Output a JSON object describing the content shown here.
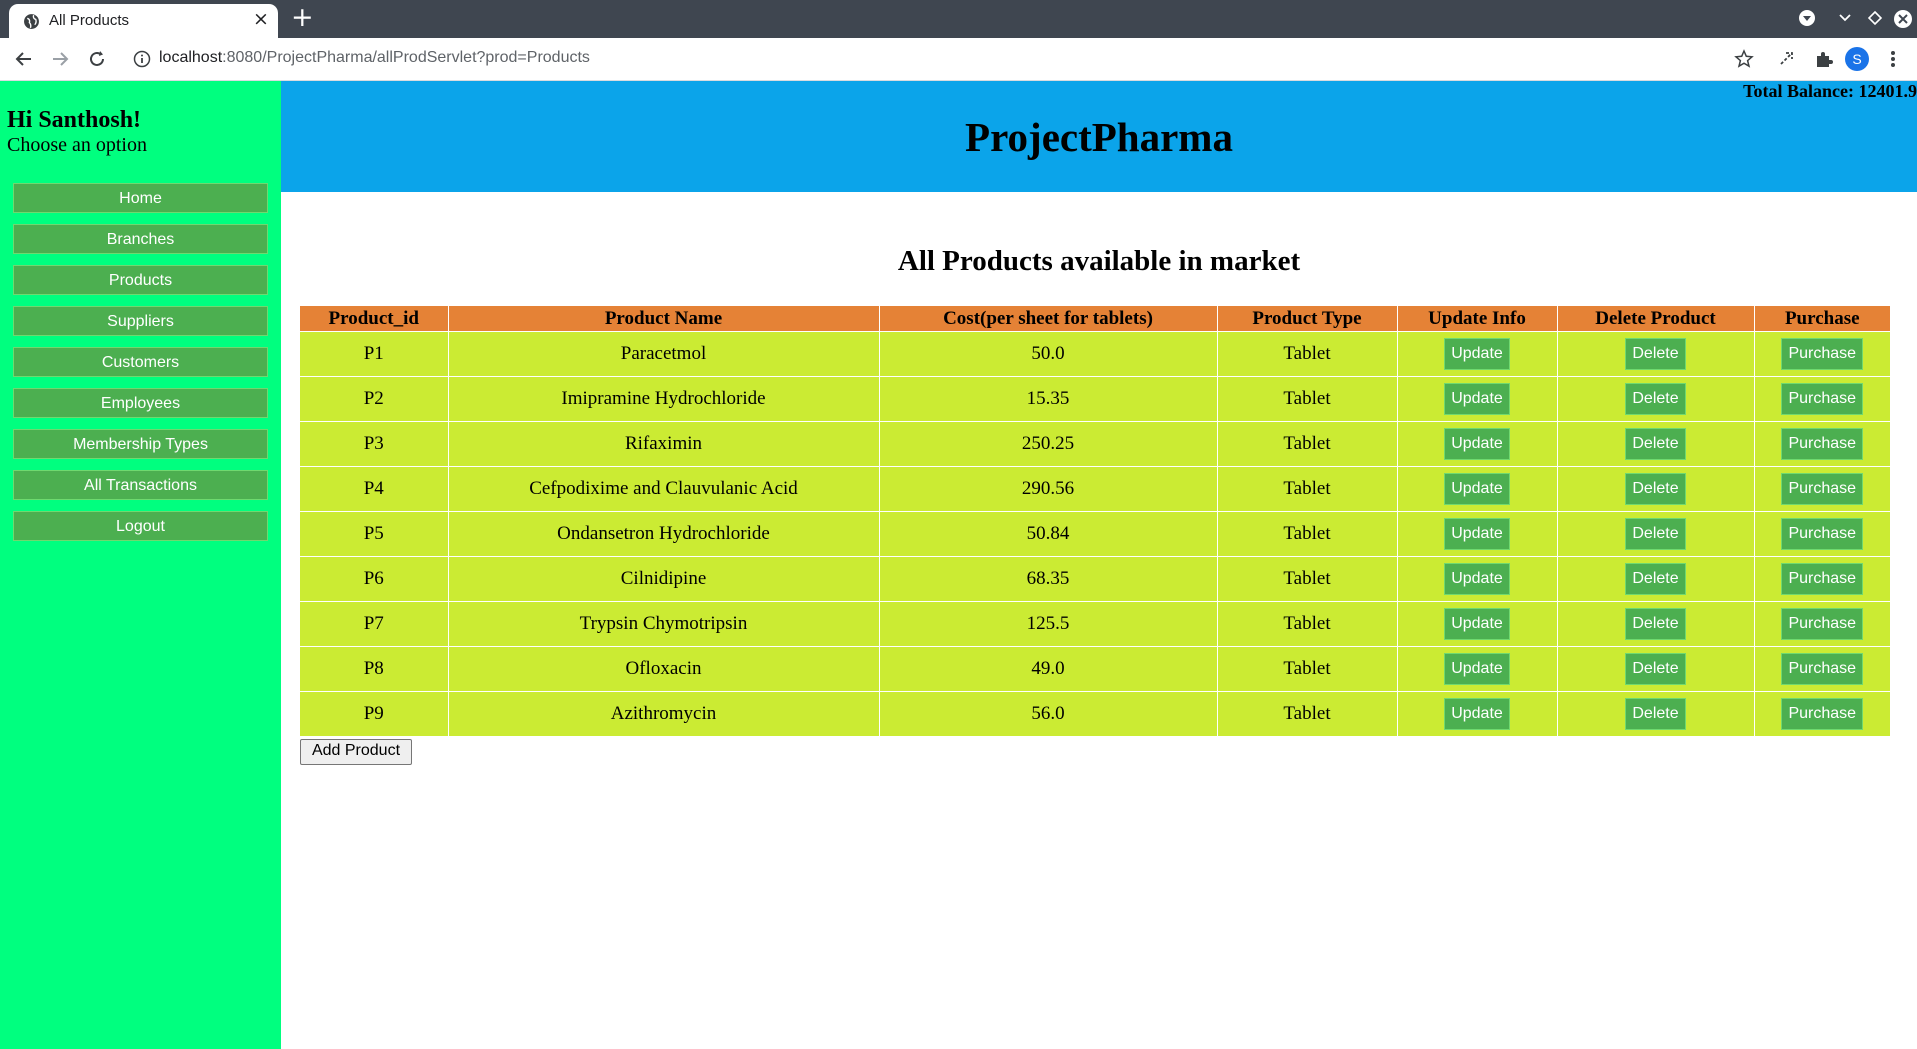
{
  "browser": {
    "tab_title": "All Products",
    "url_host": "localhost",
    "url_rest": ":8080/ProjectPharma/allProdServlet?prod=Products",
    "profile_initial": "S"
  },
  "sidebar": {
    "greeting": "Hi Santhosh!",
    "prompt": "Choose an option",
    "items": [
      {
        "label": "Home"
      },
      {
        "label": "Branches"
      },
      {
        "label": "Products"
      },
      {
        "label": "Suppliers"
      },
      {
        "label": "Customers"
      },
      {
        "label": "Employees"
      },
      {
        "label": "Membership Types"
      },
      {
        "label": "All Transactions"
      },
      {
        "label": "Logout"
      }
    ]
  },
  "header": {
    "balance": "Total Balance: 12401.9",
    "title": "ProjectPharma"
  },
  "main": {
    "heading": "All Products available in market",
    "columns": [
      "Product_id",
      "Product Name",
      "Cost(per sheet for tablets)",
      "Product Type",
      "Update Info",
      "Delete Product",
      "Purchase"
    ],
    "rows": [
      {
        "id": "P1",
        "name": "Paracetmol",
        "cost": "50.0",
        "type": "Tablet"
      },
      {
        "id": "P2",
        "name": "Imipramine Hydrochloride",
        "cost": "15.35",
        "type": "Tablet"
      },
      {
        "id": "P3",
        "name": "Rifaximin",
        "cost": "250.25",
        "type": "Tablet"
      },
      {
        "id": "P4",
        "name": "Cefpodixime and Clauvulanic Acid",
        "cost": "290.56",
        "type": "Tablet"
      },
      {
        "id": "P5",
        "name": "Ondansetron Hydrochloride",
        "cost": "50.84",
        "type": "Tablet"
      },
      {
        "id": "P6",
        "name": "Cilnidipine",
        "cost": "68.35",
        "type": "Tablet"
      },
      {
        "id": "P7",
        "name": "Trypsin Chymotripsin",
        "cost": "125.5",
        "type": "Tablet"
      },
      {
        "id": "P8",
        "name": "Ofloxacin",
        "cost": "49.0",
        "type": "Tablet"
      },
      {
        "id": "P9",
        "name": "Azithromycin",
        "cost": "56.0",
        "type": "Tablet"
      }
    ],
    "update_label": "Update",
    "delete_label": "Delete",
    "purchase_label": "Purchase",
    "add_label": "Add Product"
  }
}
